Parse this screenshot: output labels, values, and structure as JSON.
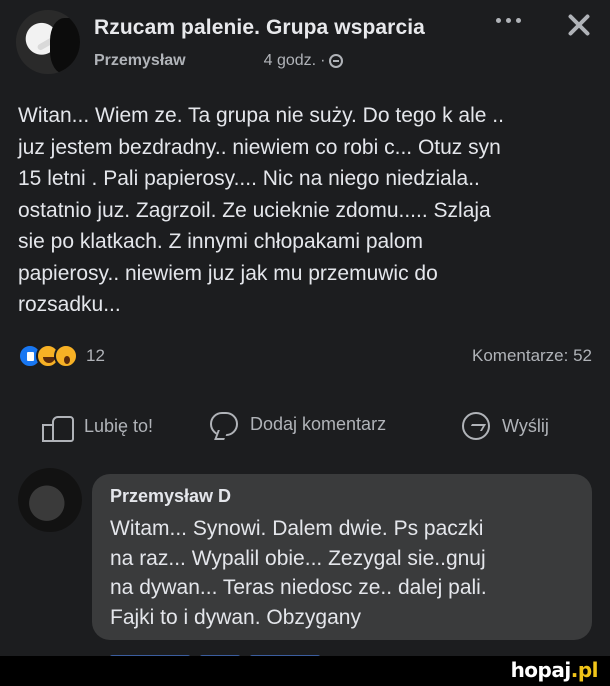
{
  "header": {
    "group_name": "Rzucam palenie. Grupa wsparcia",
    "author": "Przemysław",
    "time": "4 godz.",
    "separator": "·",
    "icons": [
      "more-icon",
      "close-icon",
      "audience-icon"
    ]
  },
  "post": {
    "lines": [
      "Witan... Wiem ze. Ta grupa nie suży. Do tego k ale ..",
      "juz jestem bezdradny.. niewiem co robi c... Otuz syn",
      "15 letni . Pali papierosy.... Nic na niego niedziala..",
      "ostatnio juz. Zagrzoil. Ze ucieknie zdomu..... Szlaja",
      "sie po klatkach. Z innymi chłopakami palom",
      "papierosy.. niewiem juz jak mu przemuwic do",
      "rozsadku..."
    ]
  },
  "reactions": {
    "count": "12",
    "comments_label": "Komentarze: 52",
    "types": [
      "like",
      "haha",
      "wow"
    ]
  },
  "actions": {
    "like": "Lubię to!",
    "comment": "Dodaj komentarz",
    "send": "Wyślij"
  },
  "comment": {
    "author": "Przemysław D",
    "lines": [
      "Witam... Synowi. Dalem dwie. Ps paczki",
      "na raz... Wypalil obie... Zezygal sie..gnuj",
      "na dywan... Teras niedosc ze.. dalej pali.",
      "Fajki to i dywan.   Obzygany"
    ]
  },
  "watermark": {
    "text": "hopaj",
    "accent": ".pl"
  },
  "colors": {
    "background": "#1c1d1f",
    "bubble": "#3a3b3c",
    "text": "#e4e6eb",
    "muted": "#b0b3b8",
    "like_blue": "#1877f2",
    "reaction_yellow": "#f7b125",
    "watermark_accent": "#f0c419"
  }
}
